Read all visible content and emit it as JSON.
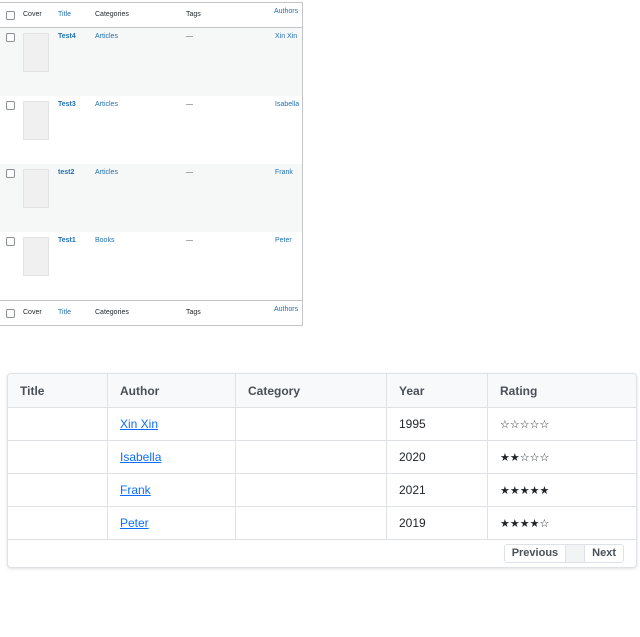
{
  "wp_table": {
    "columns": {
      "cover": "Cover",
      "title": "Title",
      "categories": "Categories",
      "tags": "Tags",
      "authors": "Authors"
    },
    "rows": [
      {
        "title": "Test4",
        "category": "Articles",
        "tags": "—",
        "author": "Xin Xin"
      },
      {
        "title": "Test3",
        "category": "Articles",
        "tags": "—",
        "author": "Isabella"
      },
      {
        "title": "test2",
        "category": "Articles",
        "tags": "—",
        "author": "Frank"
      },
      {
        "title": "Test1",
        "category": "Books",
        "tags": "—",
        "author": "Peter"
      }
    ]
  },
  "book_table": {
    "columns": {
      "title": "Title",
      "author": "Author",
      "category": "Category",
      "year": "Year",
      "rating": "Rating"
    },
    "rows": [
      {
        "title": "",
        "author": "Xin Xin",
        "category": "",
        "year": "1995",
        "rating": "☆☆☆☆☆"
      },
      {
        "title": "",
        "author": "Isabella",
        "category": "",
        "year": "2020",
        "rating": "★★☆☆☆"
      },
      {
        "title": "",
        "author": "Frank",
        "category": "",
        "year": "2021",
        "rating": "★★★★★"
      },
      {
        "title": "",
        "author": "Peter",
        "category": "",
        "year": "2019",
        "rating": "★★★★☆"
      }
    ],
    "pagination": {
      "previous": "Previous",
      "current": "",
      "next": "Next"
    }
  },
  "colors": {
    "wp_link": "#2271b1",
    "bootstrap_link": "#0d6efd",
    "row_alt": "#f6f7f7"
  }
}
